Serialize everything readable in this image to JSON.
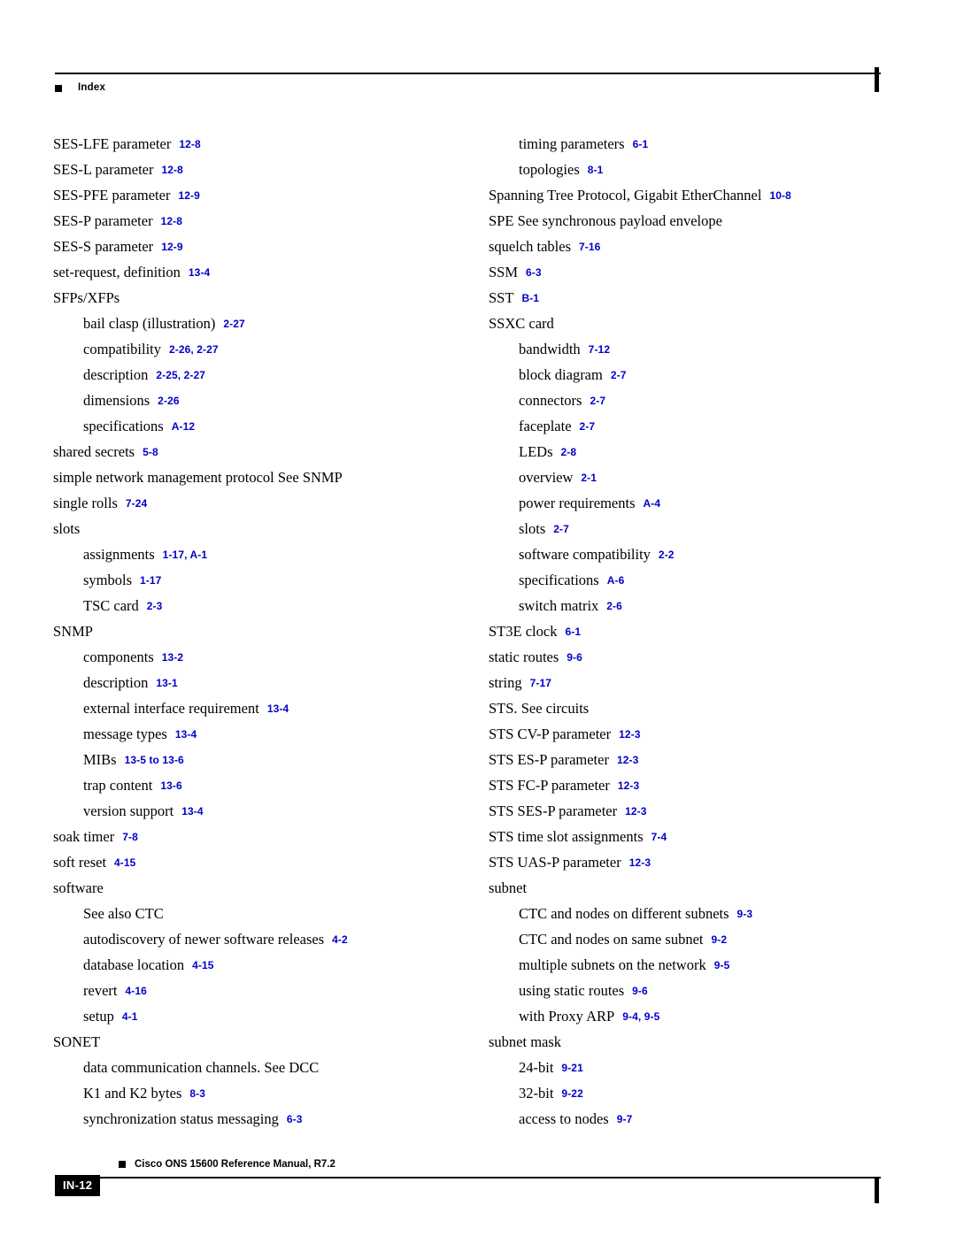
{
  "header": {
    "label": "Index"
  },
  "footer": {
    "manual": "Cisco ONS 15600 Reference Manual, R7.2",
    "page_number": "IN-12"
  },
  "columns": {
    "left": [
      {
        "level": 0,
        "term": "SES-LFE parameter",
        "ref": "12-8"
      },
      {
        "level": 0,
        "term": "SES-L parameter",
        "ref": "12-8"
      },
      {
        "level": 0,
        "term": "SES-PFE parameter",
        "ref": "12-9"
      },
      {
        "level": 0,
        "term": "SES-P parameter",
        "ref": "12-8"
      },
      {
        "level": 0,
        "term": "SES-S parameter",
        "ref": "12-9"
      },
      {
        "level": 0,
        "term": "set-request, definition",
        "ref": "13-4"
      },
      {
        "level": 0,
        "term": "SFPs/XFPs",
        "ref": ""
      },
      {
        "level": 1,
        "term": "bail clasp (illustration)",
        "ref": "2-27"
      },
      {
        "level": 1,
        "term": "compatibility",
        "ref": "2-26, 2-27"
      },
      {
        "level": 1,
        "term": "description",
        "ref": "2-25, 2-27"
      },
      {
        "level": 1,
        "term": "dimensions",
        "ref": "2-26"
      },
      {
        "level": 1,
        "term": "specifications",
        "ref": "A-12"
      },
      {
        "level": 0,
        "term": "shared secrets",
        "ref": "5-8"
      },
      {
        "level": 0,
        "term": "simple network management protocol ",
        "term_italic": "See",
        "term_after": " SNMP",
        "ref": ""
      },
      {
        "level": 0,
        "term": "single rolls",
        "ref": "7-24"
      },
      {
        "level": 0,
        "term": "slots",
        "ref": ""
      },
      {
        "level": 1,
        "term": "assignments",
        "ref": "1-17, A-1"
      },
      {
        "level": 1,
        "term": "symbols",
        "ref": "1-17"
      },
      {
        "level": 1,
        "term": "TSC card",
        "ref": "2-3"
      },
      {
        "level": 0,
        "term": "SNMP",
        "ref": ""
      },
      {
        "level": 1,
        "term": "components",
        "ref": "13-2"
      },
      {
        "level": 1,
        "term": "description",
        "ref": "13-1"
      },
      {
        "level": 1,
        "term": "external interface requirement",
        "ref": "13-4"
      },
      {
        "level": 1,
        "term": "message types",
        "ref": "13-4"
      },
      {
        "level": 1,
        "term": "MIBs",
        "ref": "13-5 to 13-6"
      },
      {
        "level": 1,
        "term": "trap content",
        "ref": "13-6"
      },
      {
        "level": 1,
        "term": "version support",
        "ref": "13-4"
      },
      {
        "level": 0,
        "term": "soak timer",
        "ref": "7-8"
      },
      {
        "level": 0,
        "term": "soft reset",
        "ref": "4-15"
      },
      {
        "level": 0,
        "term": "software",
        "ref": ""
      },
      {
        "level": 1,
        "term": "",
        "term_italic": "See also",
        "term_after": " CTC",
        "ref": ""
      },
      {
        "level": 1,
        "term": "autodiscovery of newer software releases",
        "ref": "4-2"
      },
      {
        "level": 1,
        "term": "database location",
        "ref": "4-15"
      },
      {
        "level": 1,
        "term": "revert",
        "ref": "4-16"
      },
      {
        "level": 1,
        "term": "setup",
        "ref": "4-1"
      },
      {
        "level": 0,
        "term": "SONET",
        "ref": ""
      },
      {
        "level": 1,
        "term": "data communication channels. ",
        "term_italic": "See",
        "term_after": " DCC",
        "ref": ""
      },
      {
        "level": 1,
        "term": "K1 and K2 bytes",
        "ref": "8-3"
      },
      {
        "level": 1,
        "term": "synchronization status messaging",
        "ref": "6-3"
      }
    ],
    "right": [
      {
        "level": 1,
        "term": "timing parameters",
        "ref": "6-1"
      },
      {
        "level": 1,
        "term": "topologies",
        "ref": "8-1"
      },
      {
        "level": 0,
        "term": "Spanning Tree Protocol, Gigabit EtherChannel",
        "ref": "10-8"
      },
      {
        "level": 0,
        "term": "SPE ",
        "term_italic": "See",
        "term_after": " synchronous payload envelope",
        "ref": ""
      },
      {
        "level": 0,
        "term": "squelch tables",
        "ref": "7-16"
      },
      {
        "level": 0,
        "term": "SSM",
        "ref": "6-3"
      },
      {
        "level": 0,
        "term": "SST",
        "ref": "B-1"
      },
      {
        "level": 0,
        "term": "SSXC card",
        "ref": ""
      },
      {
        "level": 1,
        "term": "bandwidth",
        "ref": "7-12"
      },
      {
        "level": 1,
        "term": "block diagram",
        "ref": "2-7"
      },
      {
        "level": 1,
        "term": "connectors",
        "ref": "2-7"
      },
      {
        "level": 1,
        "term": "faceplate",
        "ref": "2-7"
      },
      {
        "level": 1,
        "term": "LEDs",
        "ref": "2-8"
      },
      {
        "level": 1,
        "term": "overview",
        "ref": "2-1"
      },
      {
        "level": 1,
        "term": "power requirements",
        "ref": "A-4"
      },
      {
        "level": 1,
        "term": "slots",
        "ref": "2-7"
      },
      {
        "level": 1,
        "term": "software compatibility",
        "ref": "2-2"
      },
      {
        "level": 1,
        "term": "specifications",
        "ref": "A-6"
      },
      {
        "level": 1,
        "term": "switch matrix",
        "ref": "2-6"
      },
      {
        "level": 0,
        "term": "ST3E clock",
        "ref": "6-1"
      },
      {
        "level": 0,
        "term": "static routes",
        "ref": "9-6"
      },
      {
        "level": 0,
        "term": "string",
        "ref": "7-17"
      },
      {
        "level": 0,
        "term": "STS. ",
        "term_italic": "See",
        "term_after": " circuits",
        "ref": ""
      },
      {
        "level": 0,
        "term": "STS CV-P parameter",
        "ref": "12-3"
      },
      {
        "level": 0,
        "term": "STS ES-P parameter",
        "ref": "12-3"
      },
      {
        "level": 0,
        "term": "STS FC-P parameter",
        "ref": "12-3"
      },
      {
        "level": 0,
        "term": "STS SES-P parameter",
        "ref": "12-3"
      },
      {
        "level": 0,
        "term": "STS time slot assignments",
        "ref": "7-4"
      },
      {
        "level": 0,
        "term": "STS UAS-P parameter",
        "ref": "12-3"
      },
      {
        "level": 0,
        "term": "subnet",
        "ref": ""
      },
      {
        "level": 1,
        "term": "CTC and nodes on different subnets",
        "ref": "9-3"
      },
      {
        "level": 1,
        "term": "CTC and nodes on same subnet",
        "ref": "9-2"
      },
      {
        "level": 1,
        "term": "multiple subnets on the network",
        "ref": "9-5"
      },
      {
        "level": 1,
        "term": "using static routes",
        "ref": "9-6"
      },
      {
        "level": 1,
        "term": "with Proxy ARP",
        "ref": "9-4, 9-5"
      },
      {
        "level": 0,
        "term": "subnet mask",
        "ref": ""
      },
      {
        "level": 1,
        "term": "24-bit",
        "ref": "9-21"
      },
      {
        "level": 1,
        "term": "32-bit",
        "ref": "9-22"
      },
      {
        "level": 1,
        "term": "access to nodes",
        "ref": "9-7"
      }
    ]
  },
  "colors": {
    "reference_link": "#0000CC",
    "text": "#000000",
    "rule": "#000000"
  }
}
